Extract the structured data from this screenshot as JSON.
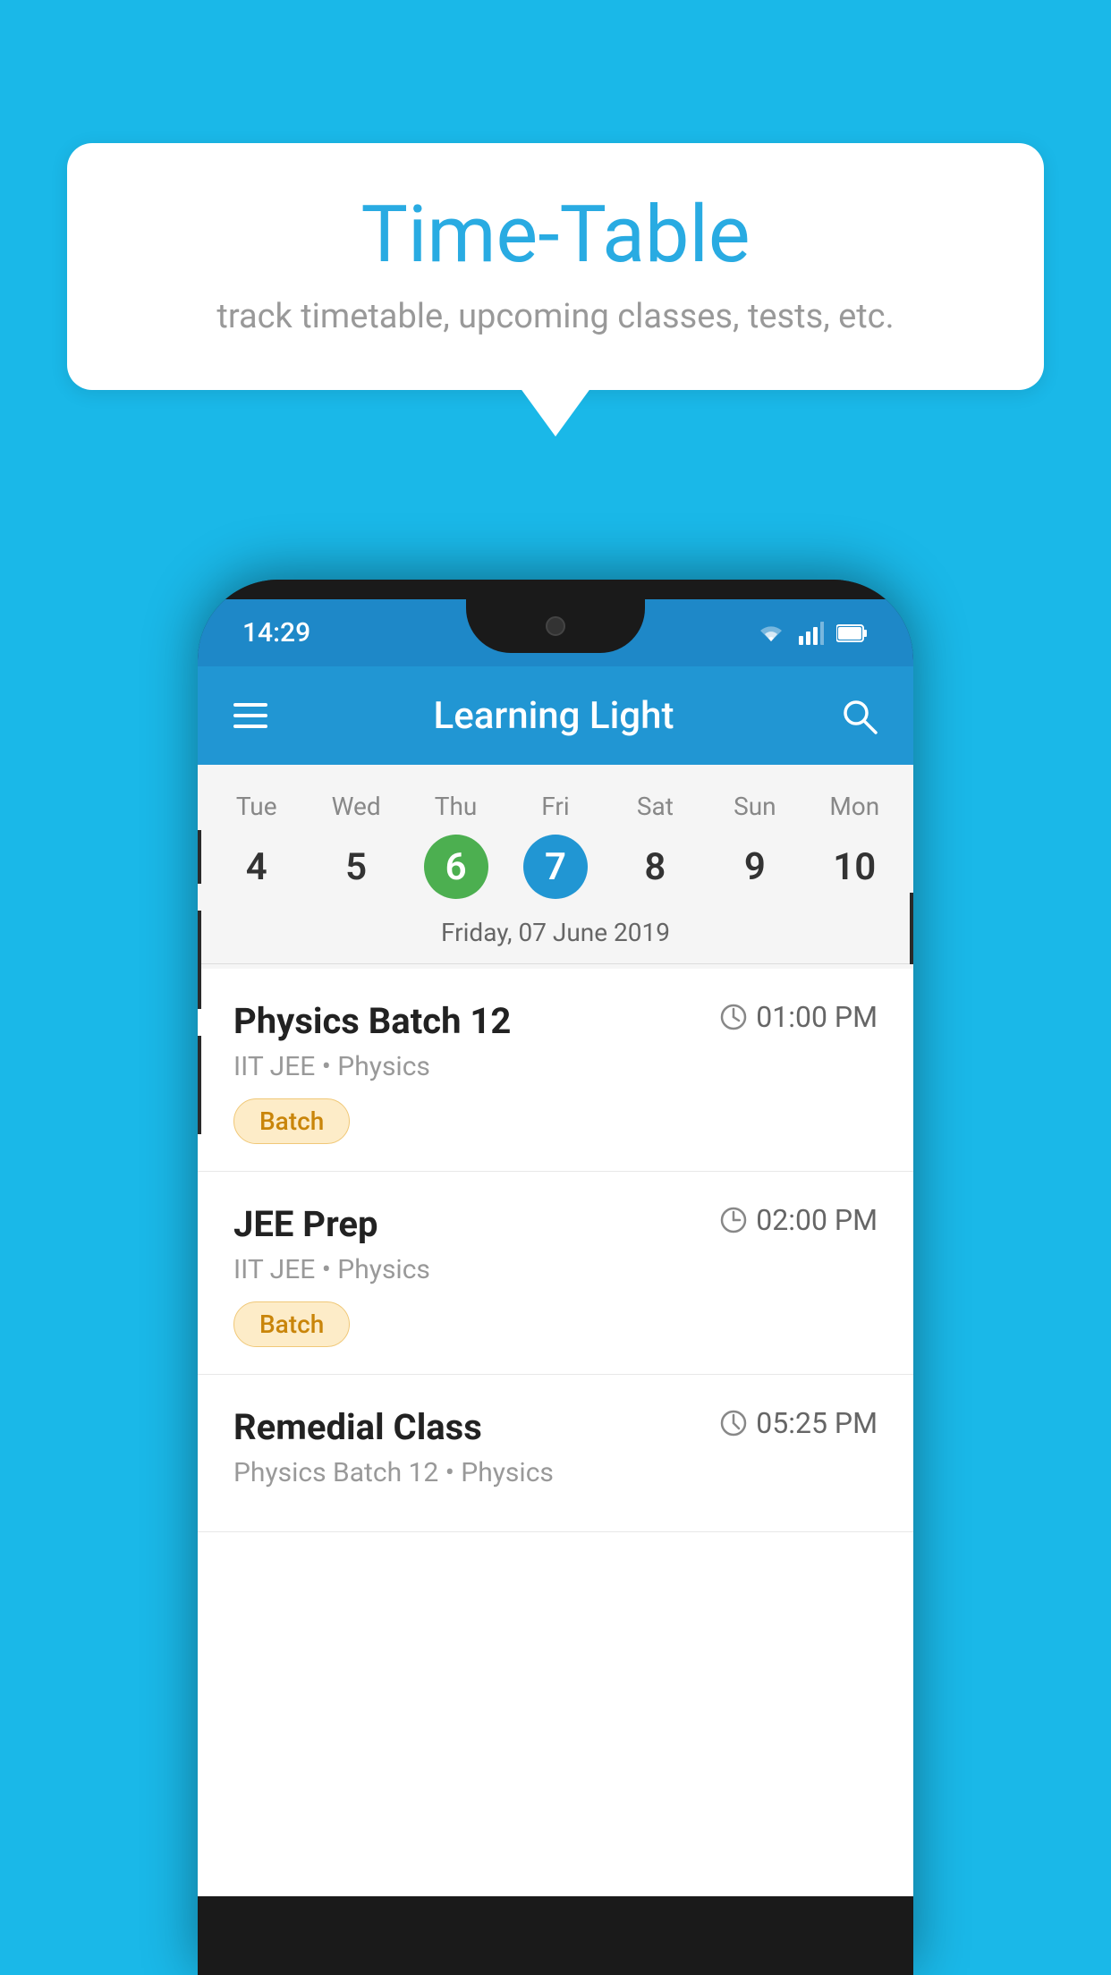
{
  "background_color": "#1ab8e8",
  "speech_bubble": {
    "title": "Time-Table",
    "subtitle": "track timetable, upcoming classes, tests, etc."
  },
  "phone": {
    "status_bar": {
      "time": "14:29",
      "wifi_icon": "wifi",
      "signal_icon": "signal",
      "battery_icon": "battery"
    },
    "app_bar": {
      "title": "Learning Light",
      "menu_icon": "menu",
      "search_icon": "search"
    },
    "calendar": {
      "days": [
        {
          "name": "Tue",
          "number": "4",
          "state": "normal"
        },
        {
          "name": "Wed",
          "number": "5",
          "state": "normal"
        },
        {
          "name": "Thu",
          "number": "6",
          "state": "today"
        },
        {
          "name": "Fri",
          "number": "7",
          "state": "selected"
        },
        {
          "name": "Sat",
          "number": "8",
          "state": "normal"
        },
        {
          "name": "Sun",
          "number": "9",
          "state": "normal"
        },
        {
          "name": "Mon",
          "number": "10",
          "state": "normal"
        }
      ],
      "selected_date_label": "Friday, 07 June 2019"
    },
    "schedule": [
      {
        "class_name": "Physics Batch 12",
        "time": "01:00 PM",
        "subject": "IIT JEE • Physics",
        "tag": "Batch"
      },
      {
        "class_name": "JEE Prep",
        "time": "02:00 PM",
        "subject": "IIT JEE • Physics",
        "tag": "Batch"
      },
      {
        "class_name": "Remedial Class",
        "time": "05:25 PM",
        "subject": "Physics Batch 12 • Physics",
        "tag": ""
      }
    ]
  }
}
